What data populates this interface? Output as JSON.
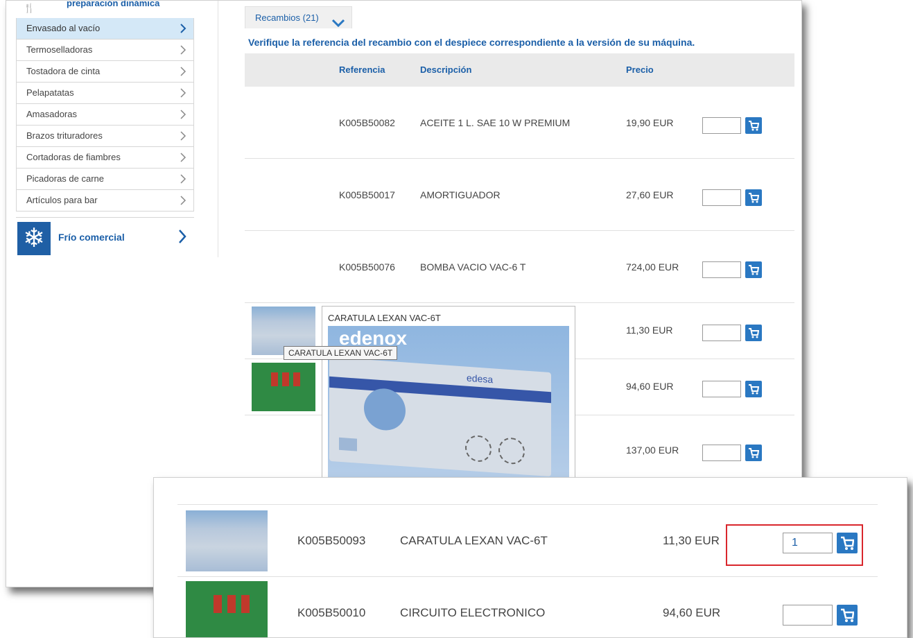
{
  "sidebar": {
    "top_partial_label": "preparación dinámica",
    "items": [
      {
        "label": "Envasado al vacío",
        "active": true
      },
      {
        "label": "Termoselladoras"
      },
      {
        "label": "Tostadora de cinta"
      },
      {
        "label": "Pelapatatas"
      },
      {
        "label": "Amasadoras"
      },
      {
        "label": "Brazos trituradores"
      },
      {
        "label": "Cortadoras de fiambres"
      },
      {
        "label": "Picadoras de carne"
      },
      {
        "label": "Artículos para bar"
      }
    ],
    "category": {
      "label": "Frío comercial",
      "icon": "snowflake-icon"
    }
  },
  "tab": {
    "label": "Recambios (21)"
  },
  "notice": "Verifique la referencia del recambio con el despiece correspondiente a la versión de su máquina.",
  "table": {
    "headers": {
      "ref": "Referencia",
      "desc": "Descripción",
      "price": "Precio"
    },
    "rows": [
      {
        "ref": "K005B50082",
        "desc": "ACEITE 1 L. SAE 10 W PREMIUM",
        "price": "19,90 EUR"
      },
      {
        "ref": "K005B50017",
        "desc": "AMORTIGUADOR",
        "price": "27,60 EUR"
      },
      {
        "ref": "K005B50076",
        "desc": "BOMBA VACIO VAC-6 T",
        "price": "724,00 EUR"
      },
      {
        "ref": "",
        "desc": "",
        "price": "11,30 EUR"
      },
      {
        "ref": "",
        "desc": "",
        "price": "94,60 EUR"
      },
      {
        "ref": "",
        "desc": "",
        "price": "137,00 EUR"
      }
    ]
  },
  "popup": {
    "title": "CARATULA LEXAN VAC-6T",
    "brand": "edenox",
    "product_brand": "edesa"
  },
  "tooltip": "CARATULA LEXAN VAC-6T",
  "zoom": {
    "rows": [
      {
        "ref": "K005B50093",
        "desc": "CARATULA LEXAN VAC-6T",
        "price": "11,30 EUR",
        "qty": "1"
      },
      {
        "ref": "K005B50010",
        "desc": "CIRCUITO ELECTRONICO",
        "price": "94,60 EUR",
        "qty": ""
      }
    ]
  },
  "colors": {
    "accent": "#1b5fa8",
    "cart": "#2a78c2",
    "highlight": "#d9262c",
    "active_row": "#d4e8f7"
  }
}
